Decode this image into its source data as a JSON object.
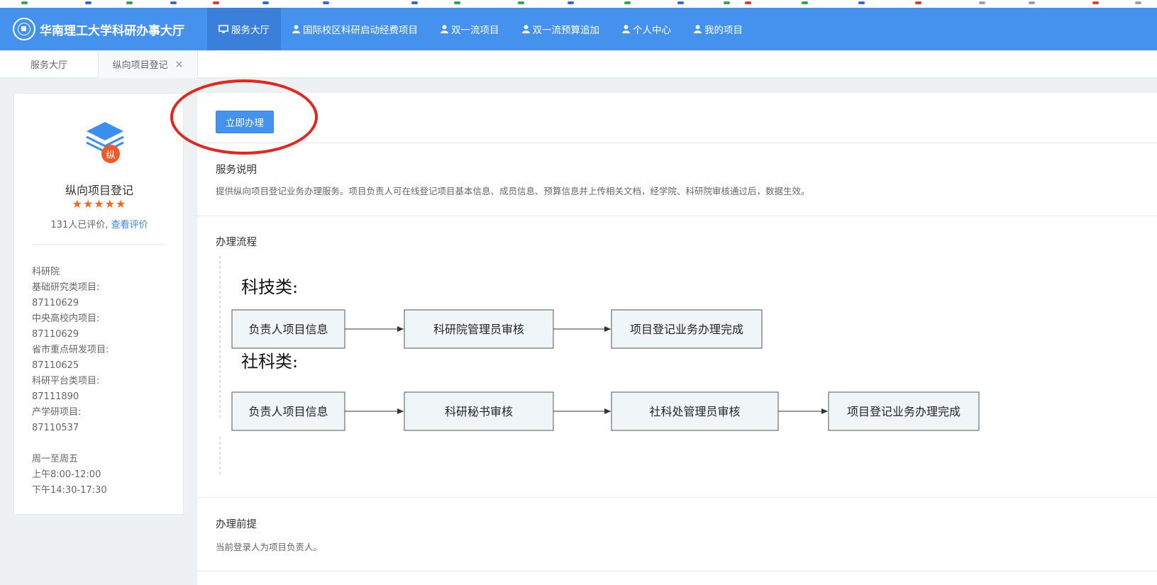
{
  "navbar": {
    "brand_title": "华南理工大学科研办事大厅",
    "items": [
      {
        "label": "服务大厅",
        "icon": "monitor-icon",
        "active": true
      },
      {
        "label": "国际校区科研启动经费项目",
        "icon": "user-icon"
      },
      {
        "label": "双一流项目",
        "icon": "user-icon"
      },
      {
        "label": "双一流预算追加",
        "icon": "user-icon"
      },
      {
        "label": "个人中心",
        "icon": "user-icon"
      },
      {
        "label": "我的项目",
        "icon": "user-icon"
      }
    ]
  },
  "tabs": [
    {
      "label": "服务大厅",
      "closable": false
    },
    {
      "label": "纵向项目登记",
      "closable": true,
      "close_glyph": "×"
    }
  ],
  "service": {
    "badge": "纵",
    "name": "纵向项目登记",
    "stars": "★★★★★",
    "rating_count": "131人已评价,",
    "rating_link": "查看评价"
  },
  "contact": {
    "lines": [
      "科研院",
      "基础研究类项目:",
      "87110629",
      "中央高校内项目:",
      "87110629",
      "省市重点研发项目:",
      "87110625",
      "科研平台类项目:",
      "87111890",
      "产学研项目:",
      "87110537"
    ],
    "hours": [
      "周一至周五",
      "上午8:00-12:00",
      "下午14:30-17:30"
    ]
  },
  "main": {
    "apply_button": "立即办理",
    "description_title": "服务说明",
    "description_text": "提供纵向项目登记业务办理服务。项目负责人可在线登记项目基本信息、成员信息、预算信息并上传相关文档，经学院、科研院审核通过后，数据生效。",
    "process_title": "办理流程",
    "prereq_title": "办理前提",
    "prereq_text": "当前登录人为项目负责人。"
  },
  "flow": {
    "tech": {
      "heading": "科技类:",
      "steps": [
        "负责人项目信息",
        "科研院管理员审核",
        "项目登记业务办理完成"
      ]
    },
    "social": {
      "heading": "社科类:",
      "steps": [
        "负责人项目信息",
        "科研秘书审核",
        "社科处管理员审核",
        "项目登记业务办理完成"
      ]
    }
  },
  "colors": {
    "primary": "#4591ee",
    "star": "#f06b1f",
    "badge": "#f05a28",
    "highlight": "#e8231c"
  }
}
